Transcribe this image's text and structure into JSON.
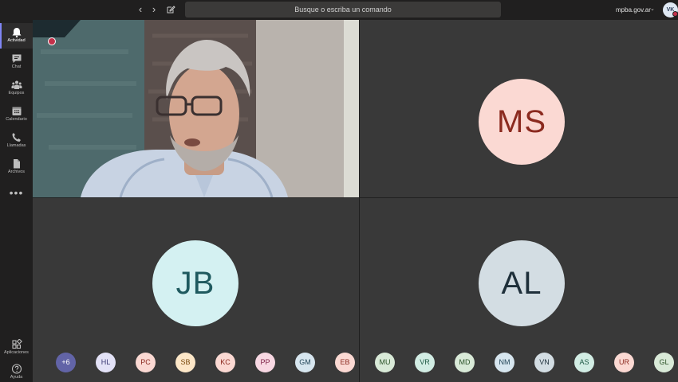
{
  "topbar": {
    "back_glyph": "‹",
    "forward_glyph": "›",
    "search_placeholder": "Busque o escriba un comando",
    "tenant": "mpba.gov.ar",
    "tenant_chevron": "⌄",
    "user_initials": "VK"
  },
  "rail": {
    "items": [
      {
        "label": "Actividad",
        "icon": "bell-icon"
      },
      {
        "label": "Chat",
        "icon": "chat-icon"
      },
      {
        "label": "Equipos",
        "icon": "teams-icon"
      },
      {
        "label": "Calendario",
        "icon": "calendar-icon"
      },
      {
        "label": "Llamadas",
        "icon": "phone-icon"
      },
      {
        "label": "Archivos",
        "icon": "files-icon"
      }
    ],
    "more": "•••",
    "apps_label": "Aplicaciones",
    "help_label": "Ayuda"
  },
  "tiles": {
    "ms": {
      "initials": "MS",
      "bg": "#fbd9d3",
      "fg": "#8b2a1f"
    },
    "jb": {
      "initials": "JB",
      "bg": "#d4f1f2",
      "fg": "#1f5a5f"
    },
    "al": {
      "initials": "AL",
      "bg": "#d3dde3",
      "fg": "#1e2f3a"
    }
  },
  "strip": [
    {
      "initials": "+6",
      "bg": "#6264a7",
      "fg": "#ffffff"
    },
    {
      "initials": "HL",
      "bg": "#e3e2f7",
      "fg": "#3b3a74"
    },
    {
      "initials": "PC",
      "bg": "#fbd9d3",
      "fg": "#8b2a1f"
    },
    {
      "initials": "SB",
      "bg": "#fde7c8",
      "fg": "#7a4a0e"
    },
    {
      "initials": "KC",
      "bg": "#fbd9d3",
      "fg": "#8b2a1f"
    },
    {
      "initials": "PP",
      "bg": "#f8d8e3",
      "fg": "#7d2246"
    },
    {
      "initials": "GM",
      "bg": "#d7e6ef",
      "fg": "#254759"
    },
    {
      "initials": "EB",
      "bg": "#fbd9d3",
      "fg": "#8b2a1f"
    },
    {
      "initials": "MU",
      "bg": "#d9ead8",
      "fg": "#2c5329"
    },
    {
      "initials": "VR",
      "bg": "#d2ede4",
      "fg": "#1f5a45"
    },
    {
      "initials": "MD",
      "bg": "#d9ead8",
      "fg": "#2c5329"
    },
    {
      "initials": "NM",
      "bg": "#d7e6ef",
      "fg": "#254759"
    },
    {
      "initials": "VN",
      "bg": "#d3dde3",
      "fg": "#1e2f3a"
    },
    {
      "initials": "AS",
      "bg": "#d2ede4",
      "fg": "#1f5a45"
    },
    {
      "initials": "UR",
      "bg": "#fbd9d3",
      "fg": "#8b2a1f"
    },
    {
      "initials": "GL",
      "bg": "#d9ead8",
      "fg": "#2c5329"
    }
  ]
}
